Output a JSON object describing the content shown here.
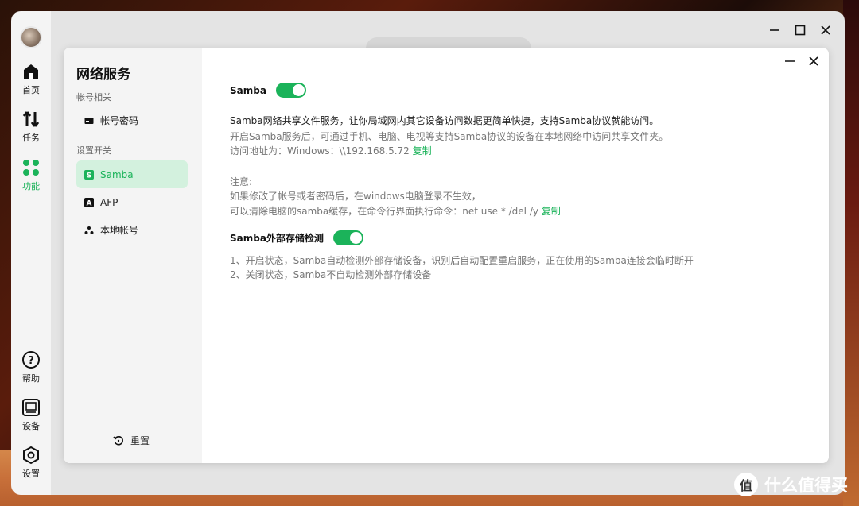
{
  "rail": {
    "items": [
      {
        "label": "首页"
      },
      {
        "label": "任务"
      },
      {
        "label": "功能"
      },
      {
        "label": "帮助"
      },
      {
        "label": "设备"
      },
      {
        "label": "设置"
      }
    ]
  },
  "sidebar": {
    "title": "网络服务",
    "sections": [
      "帐号相关",
      "设置开关"
    ],
    "items": [
      {
        "label": "帐号密码"
      },
      {
        "label": "Samba"
      },
      {
        "label": "AFP"
      },
      {
        "label": "本地帐号"
      }
    ],
    "reset_label": "重置"
  },
  "content": {
    "samba_title": "Samba",
    "samba_enabled": true,
    "desc1": "Samba网络共享文件服务，让你局域网内其它设备访问数据更简单快捷，支持Samba协议就能访问。",
    "desc2": "开启Samba服务后，可通过手机、电脑、电视等支持Samba协议的设备在本地网络中访问共享文件夹。",
    "address_prefix": "访问地址为：Windows：\\\\192.168.5.72 ",
    "copy_label": "复制",
    "note_title": "注意:",
    "note1": "如果修改了帐号或者密码后，在windows电脑登录不生效，",
    "note2_prefix": "可以清除电脑的samba缓存，在命令行界面执行命令：net use * /del /y ",
    "copy_label2": "复制",
    "ext_title": "Samba外部存储检测",
    "ext_enabled": true,
    "ext1": "1、开启状态，Samba自动检测外部存储设备，识别后自动配置重启服务，正在使用的Samba连接会临时断开",
    "ext2": "2、关闭状态，Samba不自动检测外部存储设备"
  },
  "watermark": {
    "text": "什么值得买",
    "logo": "值"
  },
  "colors": {
    "accent": "#1bb35a",
    "active_bg": "#d3f1de"
  }
}
